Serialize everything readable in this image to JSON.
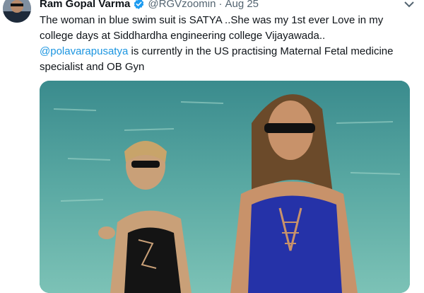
{
  "author": {
    "name": "Ram Gopal Varma",
    "handle": "@RGVzoomin",
    "separator": "·",
    "date": "Aug 25",
    "verified_icon": "verified-badge-icon",
    "avatar": "author-avatar"
  },
  "tweet": {
    "line1": "The woman in blue swim suit is SATYA ..She was my 1st ever Love in my",
    "line2": "college days at Siddhardha engineering college Vijayawada..",
    "mention": "@polavarapusatya",
    "line3_rest": " is currently in the US practising Maternal Fetal medicine",
    "line4": "specialist and OB Gyn"
  },
  "media": {
    "kind": "photo",
    "scene": "two women at the beach in swimsuits, sea in background"
  },
  "colors": {
    "text": "#0f1419",
    "secondary": "#536471",
    "link": "#1b95e0",
    "verified": "#1d9bf0"
  },
  "icons": [
    "verified-badge-icon",
    "more-caret-icon"
  ]
}
